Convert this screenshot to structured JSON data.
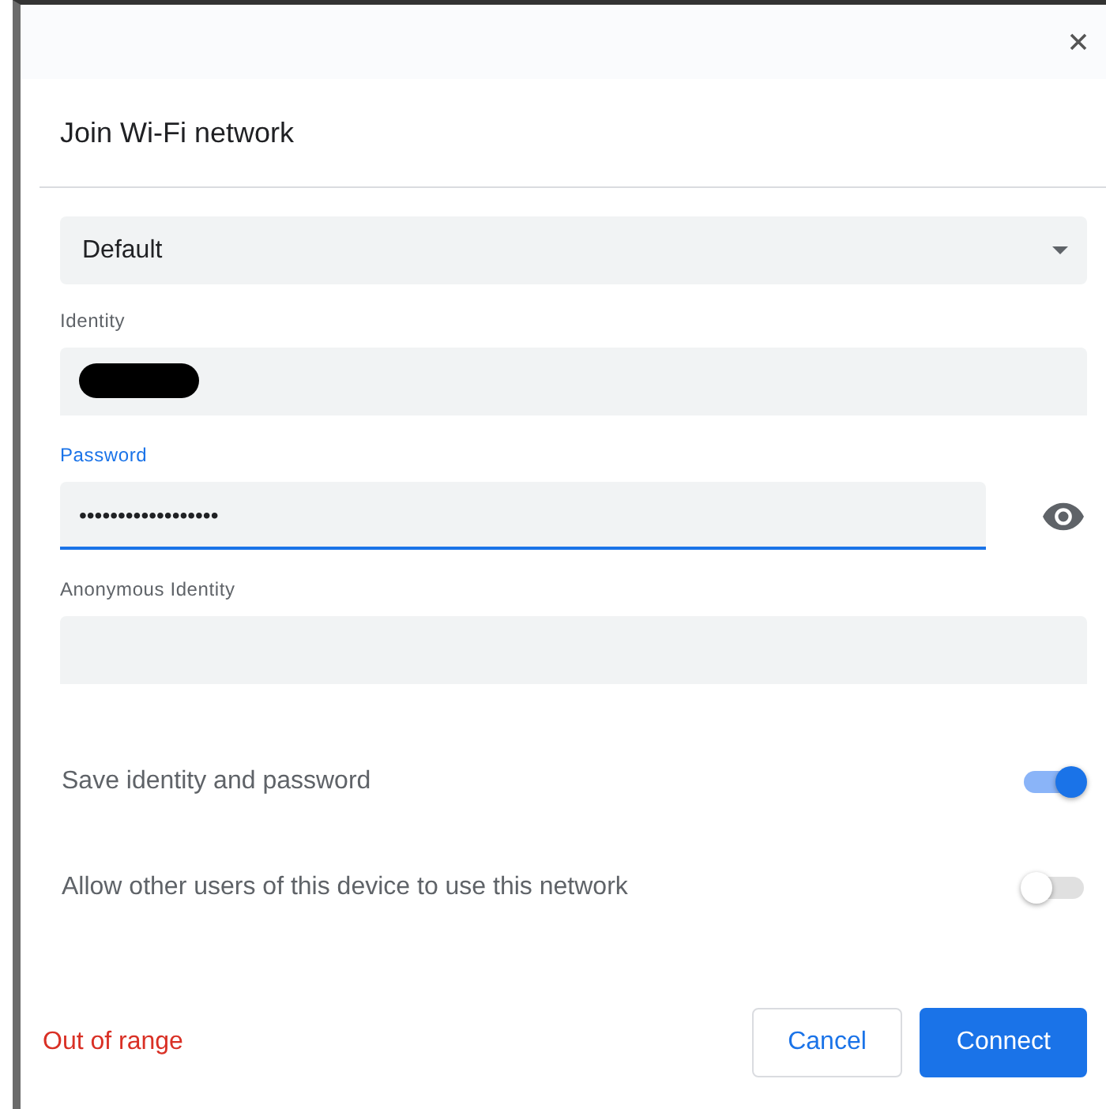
{
  "dialog": {
    "title": "Join Wi-Fi network"
  },
  "fields": [
    {
      "kind": "select",
      "value": "Default"
    },
    {
      "kind": "text",
      "label": "Identity",
      "redacted": true,
      "focused": false
    },
    {
      "kind": "password",
      "label": "Password",
      "value": "••••••••••••••••••",
      "focused": true
    },
    {
      "kind": "text",
      "label": "Anonymous Identity",
      "redacted": false,
      "focused": false
    }
  ],
  "toggles": [
    {
      "label": "Save identity and password",
      "on": true
    },
    {
      "label": "Allow other users of this device to use this network",
      "on": false
    }
  ],
  "status": "Out of range",
  "buttons": [
    {
      "label": "Cancel",
      "kind": "secondary"
    },
    {
      "label": "Connect",
      "kind": "primary"
    }
  ]
}
